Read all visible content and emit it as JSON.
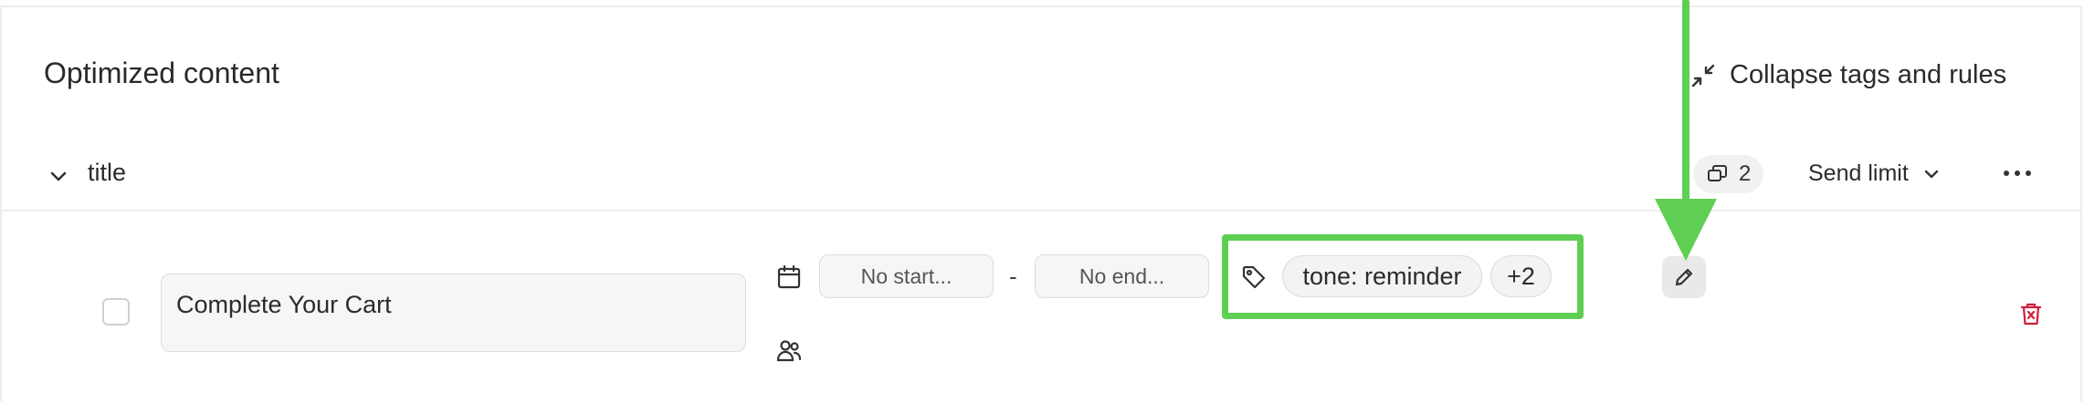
{
  "header": {
    "title": "Optimized content",
    "collapse_label": "Collapse tags and rules"
  },
  "group": {
    "title": "title",
    "variant_count": "2",
    "send_limit_label": "Send limit"
  },
  "item": {
    "text_value": "Complete Your Cart",
    "start_placeholder": "No start...",
    "date_separator": "-",
    "end_placeholder": "No end...",
    "tags": [
      {
        "label": "tone: reminder"
      },
      {
        "label": "+2"
      }
    ]
  },
  "colors": {
    "highlight": "#5fcf53",
    "delete": "#d0203a",
    "chip_bg": "#f3f3f3"
  },
  "icons": [
    "collapse-icon",
    "chevron-down-icon",
    "copies-icon",
    "more-icon",
    "calendar-icon",
    "people-icon",
    "tag-icon",
    "pencil-icon",
    "trash-icon"
  ]
}
